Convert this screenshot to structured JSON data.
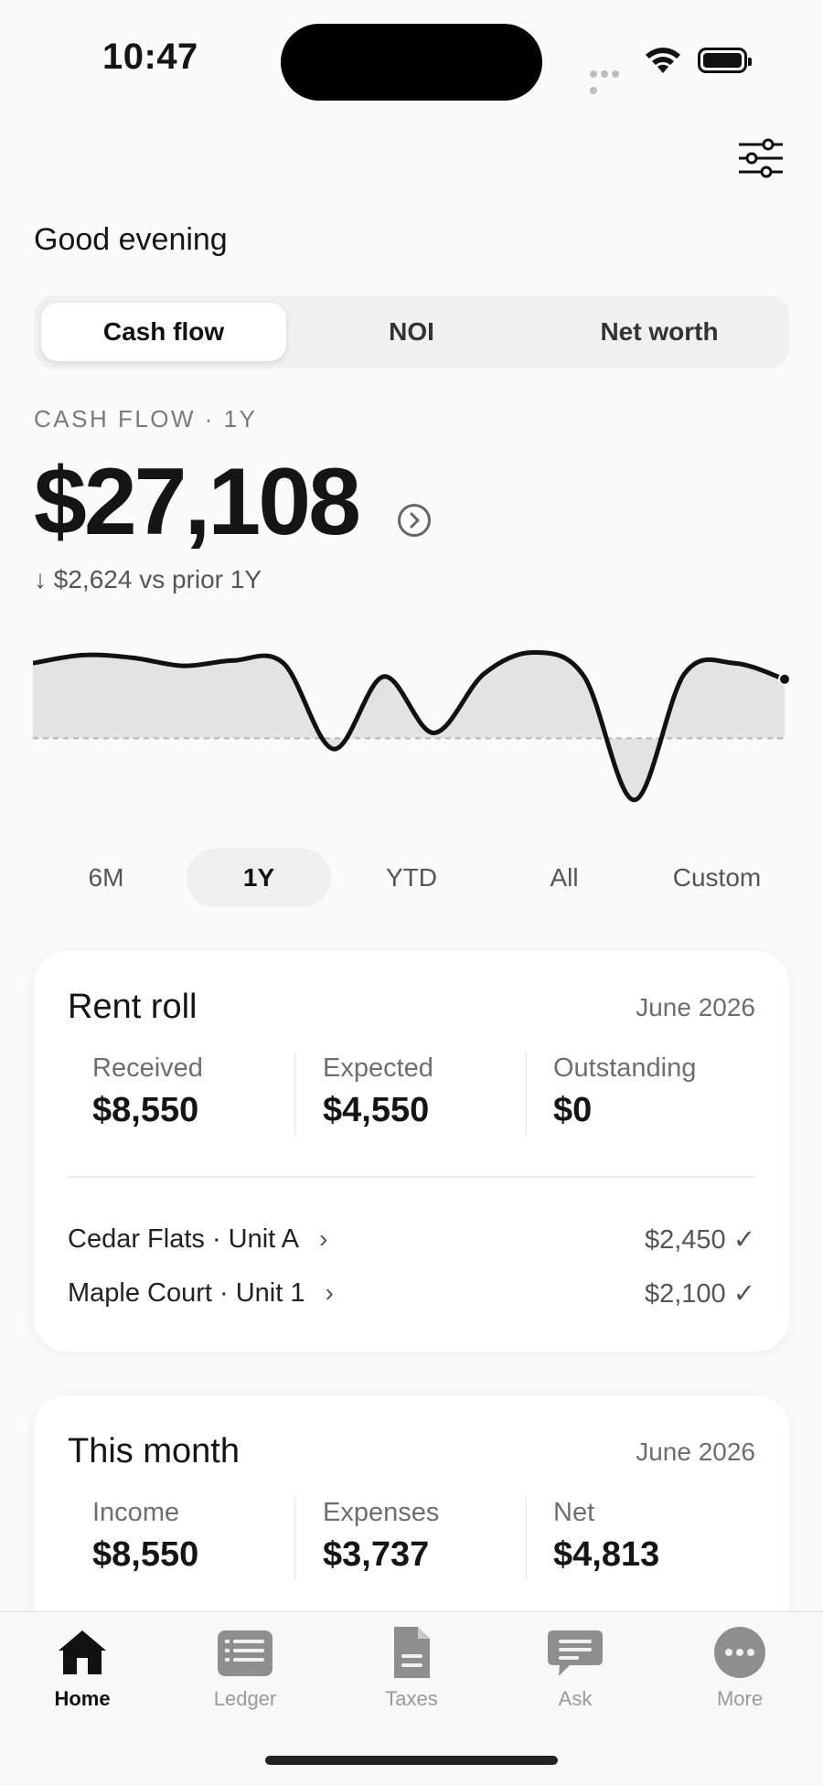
{
  "status_bar": {
    "time": "10:47"
  },
  "header": {
    "greeting": "Good evening"
  },
  "segments": [
    {
      "label": "Cash flow",
      "active": true
    },
    {
      "label": "NOI",
      "active": false
    },
    {
      "label": "Net worth",
      "active": false
    }
  ],
  "summary": {
    "kicker": "CASH FLOW · 1Y",
    "amount": "$27,108",
    "delta": "↓ $2,624 vs prior 1Y"
  },
  "chart_data": {
    "type": "area",
    "title": "",
    "xlabel": "",
    "ylabel": "",
    "baseline": 0,
    "ylim": [
      -3500,
      4000
    ],
    "grid": false,
    "values": [
      2800,
      3100,
      3000,
      2700,
      2900,
      2800,
      -400,
      2300,
      200,
      2400,
      3200,
      2300,
      -2300,
      2400,
      2800,
      2200
    ],
    "line_color": "#111111",
    "fill_color": "#e3e3e3"
  },
  "ranges": [
    {
      "label": "6M",
      "active": false
    },
    {
      "label": "1Y",
      "active": true
    },
    {
      "label": "YTD",
      "active": false
    },
    {
      "label": "All",
      "active": false
    },
    {
      "label": "Custom",
      "active": false
    }
  ],
  "rent_roll": {
    "title": "Rent roll",
    "date": "June 2026",
    "stats": [
      {
        "label": "Received",
        "value": "$8,550"
      },
      {
        "label": "Expected",
        "value": "$4,550"
      },
      {
        "label": "Outstanding",
        "value": "$0"
      }
    ],
    "rows": [
      {
        "name": "Cedar Flats · Unit A",
        "chev": "›",
        "amount": "$2,450 ✓"
      },
      {
        "name": "Maple Court · Unit 1",
        "chev": "›",
        "amount": "$2,100 ✓"
      }
    ]
  },
  "this_month": {
    "title": "This month",
    "date": "June 2026",
    "stats": [
      {
        "label": "Income",
        "value": "$8,550"
      },
      {
        "label": "Expenses",
        "value": "$3,737"
      },
      {
        "label": "Net",
        "value": "$4,813"
      }
    ]
  },
  "tabs": [
    {
      "label": "Home",
      "icon": "home-icon",
      "active": true
    },
    {
      "label": "Ledger",
      "icon": "ledger-icon",
      "active": false
    },
    {
      "label": "Taxes",
      "icon": "document-icon",
      "active": false
    },
    {
      "label": "Ask",
      "icon": "chat-icon",
      "active": false
    },
    {
      "label": "More",
      "icon": "more-icon",
      "active": false
    }
  ]
}
